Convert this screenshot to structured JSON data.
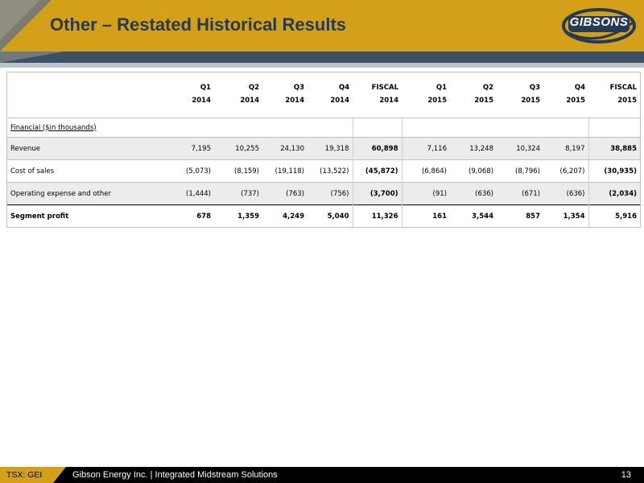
{
  "header": {
    "title": "Other – Restated Historical Results",
    "logo_text": "GIBSONS"
  },
  "table": {
    "columns": [
      {
        "q": "Q1",
        "year": "2014"
      },
      {
        "q": "Q2",
        "year": "2014"
      },
      {
        "q": "Q3",
        "year": "2014"
      },
      {
        "q": "Q4",
        "year": "2014"
      },
      {
        "q": "FISCAL",
        "year": "2014"
      },
      {
        "q": "Q1",
        "year": "2015"
      },
      {
        "q": "Q2",
        "year": "2015"
      },
      {
        "q": "Q3",
        "year": "2015"
      },
      {
        "q": "Q4",
        "year": "2015"
      },
      {
        "q": "FISCAL",
        "year": "2015"
      }
    ],
    "section_label": "Financial ($in thousands)",
    "rows": [
      {
        "label": "Revenue",
        "values": [
          "7,195",
          "10,255",
          "24,130",
          "19,318",
          "60,898",
          "7,116",
          "13,248",
          "10,324",
          "8,197",
          "38,885"
        ]
      },
      {
        "label": "Cost of sales",
        "values": [
          "(5,073)",
          "(8,159)",
          "(19,118)",
          "(13,522)",
          "(45,872)",
          "(6,864)",
          "(9,068)",
          "(8,796)",
          "(6,207)",
          "(30,935)"
        ]
      },
      {
        "label": "Operating expense and other",
        "values": [
          "(1,444)",
          "(737)",
          "(763)",
          "(756)",
          "(3,700)",
          "(91)",
          "(636)",
          "(671)",
          "(636)",
          "(2,034)"
        ]
      },
      {
        "label": "Segment profit",
        "values": [
          "678",
          "1,359",
          "4,249",
          "5,040",
          "11,326",
          "161",
          "3,544",
          "857",
          "1,354",
          "5,916"
        ]
      }
    ]
  },
  "footer": {
    "ticker": "TSX: GEI",
    "company": "Gibson Energy Inc.  |  Integrated Midstream Solutions",
    "page_number": "13"
  },
  "colors": {
    "gold": "#d4a017",
    "navy_title": "#243a56",
    "dark_bar": "#3c5068"
  }
}
